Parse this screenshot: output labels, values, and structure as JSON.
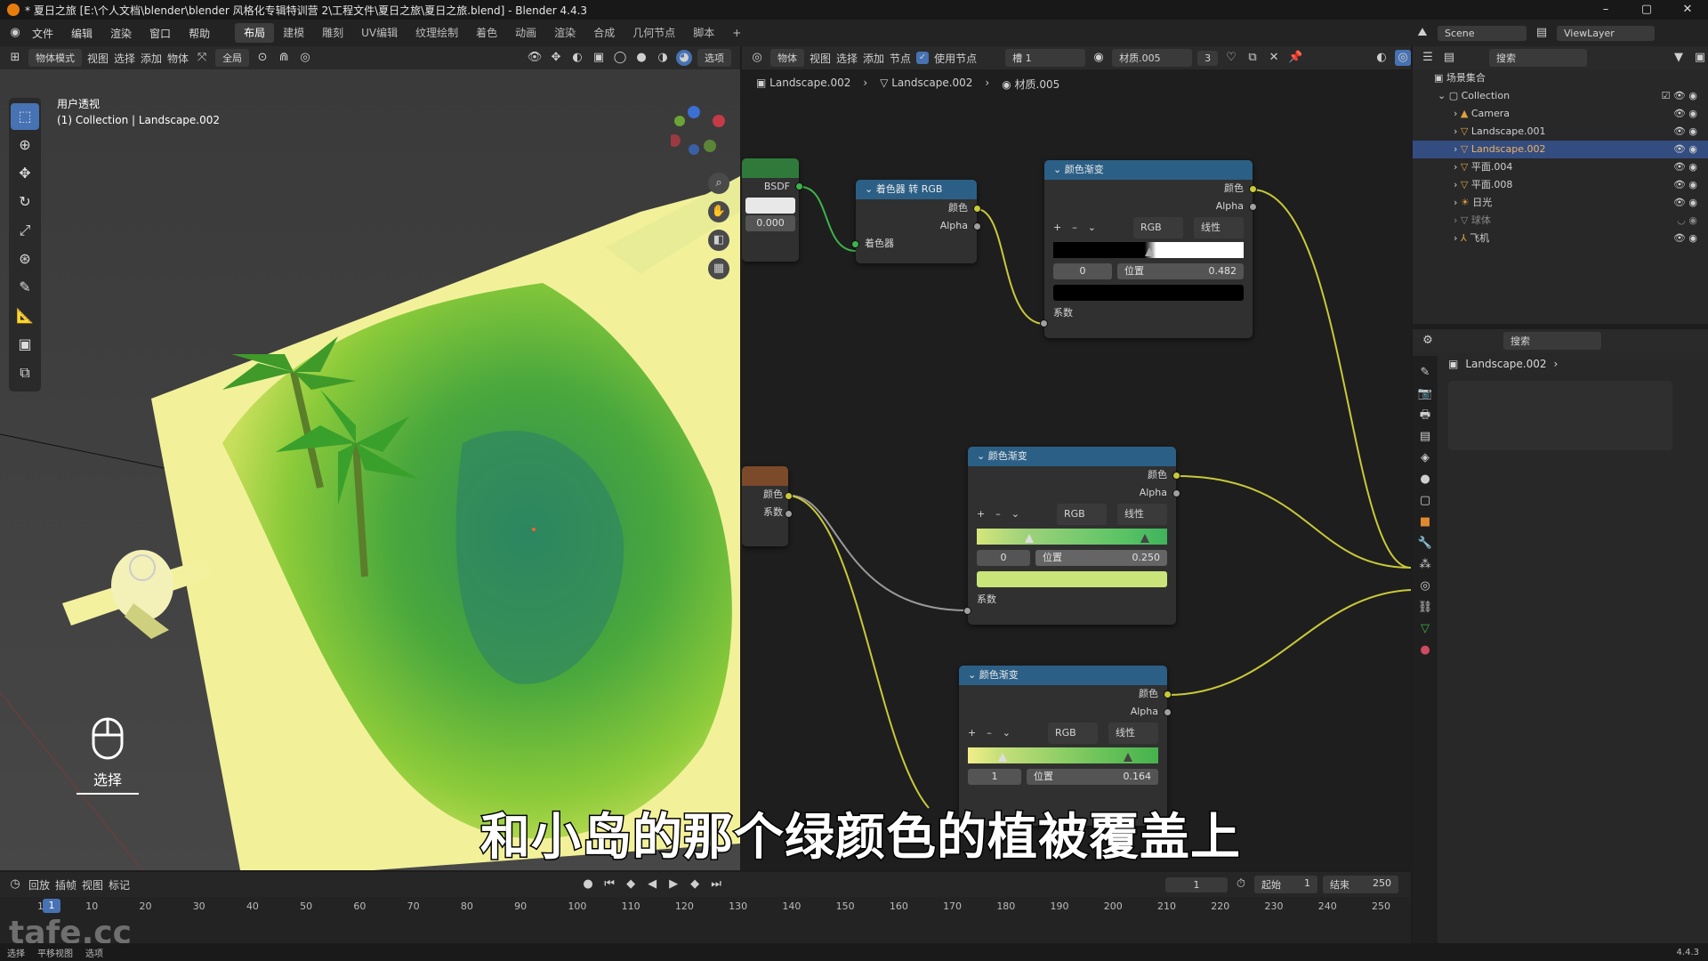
{
  "window": {
    "title": "* 夏日之旅 [E:\\个人文档\\blender\\blender 风格化专辑特训营 2\\工程文件\\夏日之旅\\夏日之旅.blend] - Blender 4.4.3",
    "minimize": "–",
    "maximize": "▢",
    "close": "✕"
  },
  "menu": {
    "items": [
      "文件",
      "编辑",
      "渲染",
      "窗口",
      "帮助"
    ],
    "tabs": [
      "布局",
      "建模",
      "雕刻",
      "UV编辑",
      "纹理绘制",
      "着色",
      "动画",
      "渲染",
      "合成",
      "几何节点",
      "脚本"
    ],
    "active_tab": "布局",
    "add_tab": "+",
    "scene_label": "Scene",
    "viewlayer_label": "ViewLayer"
  },
  "viewport": {
    "mode": "物体模式",
    "menus": [
      "视图",
      "选择",
      "添加",
      "物体"
    ],
    "orientation": "全局",
    "options": "选项",
    "view_name": "用户透视",
    "collection_info": "(1) Collection | Landscape.002",
    "select_hint": "选择",
    "icons": [
      "select-icon",
      "cursor-icon",
      "move-icon",
      "rotate-icon",
      "scale-icon",
      "transform-icon",
      "annotate-icon",
      "measure-icon",
      "add-cube-icon",
      "extrude-icon"
    ]
  },
  "node_editor": {
    "type": "物体",
    "menus": [
      "视图",
      "选择",
      "添加",
      "节点"
    ],
    "use_nodes": "使用节点",
    "slot": "槽 1",
    "material": "材质.005",
    "users": "3",
    "breadcrumb": [
      "Landscape.002",
      "Landscape.002",
      "材质.005"
    ]
  },
  "nodes": {
    "bsdf_label": "BSDF",
    "bsdf_value": "0.000",
    "shader_to_rgb": {
      "title": "着色器 转 RGB",
      "out_color": "颜色",
      "out_alpha": "Alpha",
      "in_shader": "着色器"
    },
    "ramp1": {
      "title": "颜色渐变",
      "out_color": "颜色",
      "out_alpha": "Alpha",
      "mode": "RGB",
      "interp": "线性",
      "index": "0",
      "pos_label": "位置",
      "pos_value": "0.482",
      "in_fac": "系数"
    },
    "left_mid": {
      "color": "颜色",
      "fac": "系数"
    },
    "ramp2": {
      "title": "颜色渐变",
      "out_color": "颜色",
      "out_alpha": "Alpha",
      "mode": "RGB",
      "interp": "线性",
      "index": "0",
      "pos_label": "位置",
      "pos_value": "0.250",
      "in_fac": "系数"
    },
    "ramp3": {
      "title": "颜色渐变",
      "out_color": "颜色",
      "out_alpha": "Alpha",
      "mode": "RGB",
      "interp": "线性",
      "index": "1",
      "pos_label": "位置",
      "pos_value": "0.164"
    }
  },
  "outliner": {
    "search_placeholder": "搜索",
    "root": "场景集合",
    "collection": "Collection",
    "objects": [
      "Camera",
      "Landscape.001",
      "Landscape.002",
      "平面.004",
      "平面.008",
      "日光",
      "球体",
      "飞机"
    ],
    "selected": "Landscape.002"
  },
  "properties": {
    "search_placeholder": "搜索",
    "object": "Landscape.002"
  },
  "timeline": {
    "menus": [
      "回放",
      "插帧",
      "视图",
      "标记"
    ],
    "current_frame": "1",
    "start_label": "起始",
    "start": "1",
    "end_label": "结束",
    "end": "250",
    "ticks": [
      "1",
      "10",
      "20",
      "30",
      "40",
      "50",
      "60",
      "70",
      "80",
      "90",
      "100",
      "110",
      "120",
      "130",
      "140",
      "150",
      "160",
      "170",
      "180",
      "190",
      "200",
      "210",
      "220",
      "230",
      "240",
      "250"
    ]
  },
  "status": {
    "items": [
      "选择",
      "平移视图",
      "选项"
    ],
    "version": "4.4.3"
  },
  "subtitle": "和小岛的那个绿颜色的植被覆盖上",
  "watermark": "tafe.cc",
  "colors": {
    "accent": "#4772b3",
    "node_header_blue": "#2b5f86",
    "wire_yellow": "#c9c93a",
    "wire_green": "#3db34a"
  }
}
